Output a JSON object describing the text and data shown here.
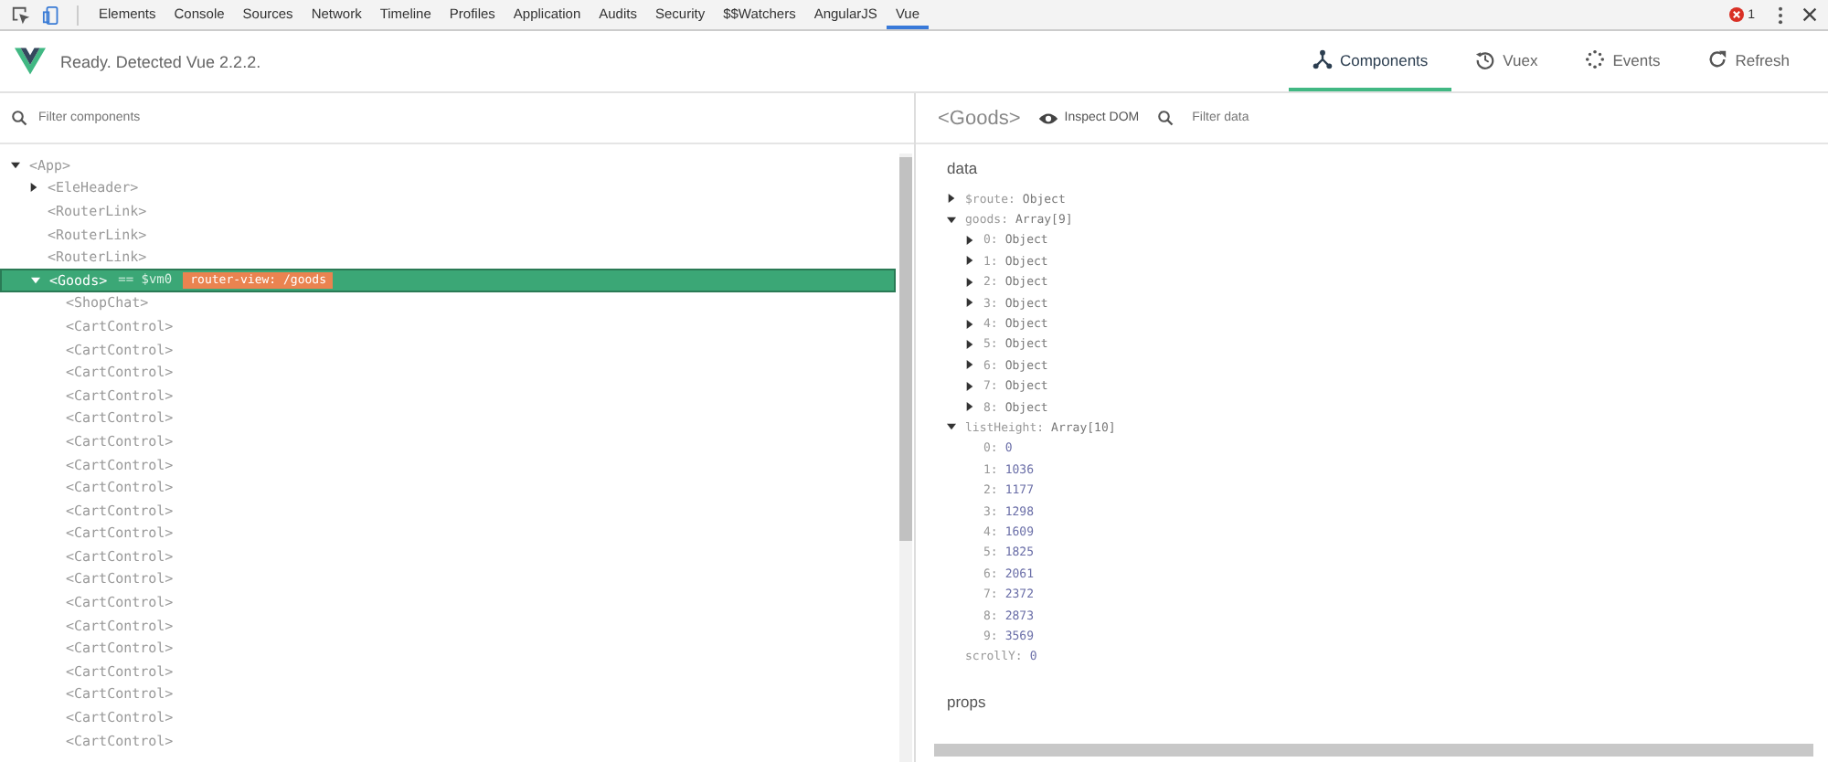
{
  "devtools_tabs": [
    {
      "label": "Elements",
      "selected": false
    },
    {
      "label": "Console",
      "selected": false
    },
    {
      "label": "Sources",
      "selected": false
    },
    {
      "label": "Network",
      "selected": false
    },
    {
      "label": "Timeline",
      "selected": false
    },
    {
      "label": "Profiles",
      "selected": false
    },
    {
      "label": "Application",
      "selected": false
    },
    {
      "label": "Audits",
      "selected": false
    },
    {
      "label": "Security",
      "selected": false
    },
    {
      "label": "$$Watchers",
      "selected": false
    },
    {
      "label": "AngularJS",
      "selected": false
    },
    {
      "label": "Vue",
      "selected": true
    }
  ],
  "error_count": "1",
  "vue_header": {
    "status": "Ready. Detected Vue 2.2.2.",
    "tabs": [
      {
        "label": "Components",
        "selected": true
      },
      {
        "label": "Vuex",
        "selected": false
      },
      {
        "label": "Events",
        "selected": false
      },
      {
        "label": "Refresh",
        "selected": false
      }
    ]
  },
  "components_filter": {
    "placeholder": "Filter components"
  },
  "component_tree": [
    {
      "label": "<App>",
      "expanded": true,
      "selected": false,
      "children": [
        {
          "label": "<EleHeader>",
          "expanded": false,
          "selected": false
        },
        {
          "label": "<RouterLink>",
          "selected": false
        },
        {
          "label": "<RouterLink>",
          "selected": false
        },
        {
          "label": "<RouterLink>",
          "selected": false
        },
        {
          "label": "<Goods>",
          "vm": "== $vm0",
          "badge": "router-view: /goods",
          "expanded": true,
          "selected": true,
          "children": [
            {
              "label": "<ShopChat>",
              "selected": false
            },
            {
              "label": "<CartControl>",
              "selected": false
            },
            {
              "label": "<CartControl>",
              "selected": false
            },
            {
              "label": "<CartControl>",
              "selected": false
            },
            {
              "label": "<CartControl>",
              "selected": false
            },
            {
              "label": "<CartControl>",
              "selected": false
            },
            {
              "label": "<CartControl>",
              "selected": false
            },
            {
              "label": "<CartControl>",
              "selected": false
            },
            {
              "label": "<CartControl>",
              "selected": false
            },
            {
              "label": "<CartControl>",
              "selected": false
            },
            {
              "label": "<CartControl>",
              "selected": false
            },
            {
              "label": "<CartControl>",
              "selected": false
            },
            {
              "label": "<CartControl>",
              "selected": false
            },
            {
              "label": "<CartControl>",
              "selected": false
            },
            {
              "label": "<CartControl>",
              "selected": false
            },
            {
              "label": "<CartControl>",
              "selected": false
            },
            {
              "label": "<CartControl>",
              "selected": false
            },
            {
              "label": "<CartControl>",
              "selected": false
            },
            {
              "label": "<CartControl>",
              "selected": false
            },
            {
              "label": "<CartControl>",
              "selected": false
            }
          ]
        }
      ]
    }
  ],
  "inspector": {
    "component": "<Goods>",
    "inspect_dom": "Inspect DOM",
    "filter_placeholder": "Filter data",
    "sections": [
      {
        "title": "data",
        "items": [
          {
            "key": "$route:",
            "value": "Object",
            "expanded": false
          },
          {
            "key": "goods:",
            "value": "Array[9]",
            "expanded": true,
            "children": [
              {
                "key": "0:",
                "value": "Object",
                "expanded": false
              },
              {
                "key": "1:",
                "value": "Object",
                "expanded": false
              },
              {
                "key": "2:",
                "value": "Object",
                "expanded": false
              },
              {
                "key": "3:",
                "value": "Object",
                "expanded": false
              },
              {
                "key": "4:",
                "value": "Object",
                "expanded": false
              },
              {
                "key": "5:",
                "value": "Object",
                "expanded": false
              },
              {
                "key": "6:",
                "value": "Object",
                "expanded": false
              },
              {
                "key": "7:",
                "value": "Object",
                "expanded": false
              },
              {
                "key": "8:",
                "value": "Object",
                "expanded": false
              }
            ]
          },
          {
            "key": "listHeight:",
            "value": "Array[10]",
            "expanded": true,
            "children": [
              {
                "key": "0:",
                "value": "0"
              },
              {
                "key": "1:",
                "value": "1036"
              },
              {
                "key": "2:",
                "value": "1177"
              },
              {
                "key": "3:",
                "value": "1298"
              },
              {
                "key": "4:",
                "value": "1609"
              },
              {
                "key": "5:",
                "value": "1825"
              },
              {
                "key": "6:",
                "value": "2061"
              },
              {
                "key": "7:",
                "value": "2372"
              },
              {
                "key": "8:",
                "value": "2873"
              },
              {
                "key": "9:",
                "value": "3569"
              }
            ]
          },
          {
            "key": "scrollY:",
            "value": "0"
          }
        ]
      },
      {
        "title": "props"
      }
    ]
  }
}
